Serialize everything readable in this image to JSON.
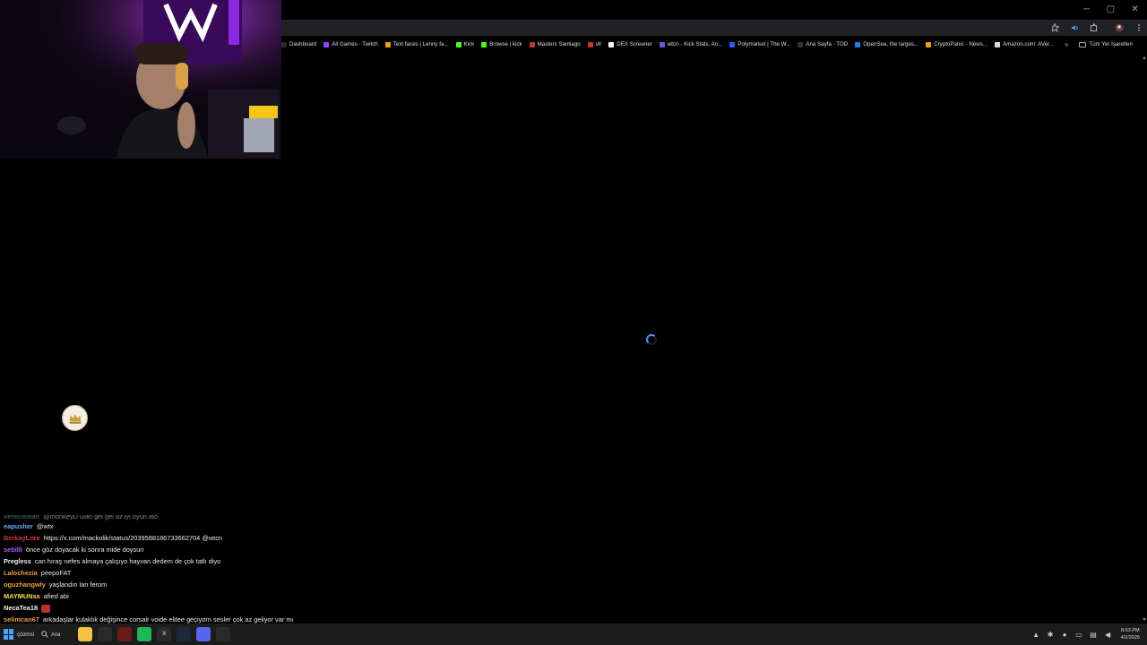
{
  "window_controls": {
    "minimize": "─",
    "maximize": "▢",
    "close": "✕"
  },
  "toolbar": {
    "icons": [
      "zoom-icon",
      "star-icon",
      "audio-icon",
      "extensions-icon",
      "profile-icon",
      "menu-icon"
    ]
  },
  "bookmarks": [
    {
      "label": "Dashboard",
      "color": "#2b2b2b"
    },
    {
      "label": "All Games - Twitch",
      "color": "#9146ff"
    },
    {
      "label": "Text faces | Lenny fa...",
      "color": "#e5a21a"
    },
    {
      "label": "Kick",
      "color": "#53fc18"
    },
    {
      "label": "Browse | kick",
      "color": "#53fc18"
    },
    {
      "label": "Masters Santiago",
      "color": "#b23b3b"
    },
    {
      "label": "vlr",
      "color": "#c0392b"
    },
    {
      "label": "DEX Screener",
      "color": "#ffffff"
    },
    {
      "label": "wtcn - Kick Stats, An...",
      "color": "#6a5acd"
    },
    {
      "label": "Polymarket | The W...",
      "color": "#2e5bff"
    },
    {
      "label": "Ana Sayfa - TOD",
      "color": "#333333"
    },
    {
      "label": "OpenSea, the larges...",
      "color": "#2081e2"
    },
    {
      "label": "CryptoPanic - News...",
      "color": "#f39c12"
    },
    {
      "label": "Amazon.com: AVer...",
      "color": "#dddddd"
    }
  ],
  "bookmarks_more": "»",
  "bookmarks_all": "Tüm Yer İşaretleri",
  "chat": {
    "faded_line": {
      "user": "vehicleman",
      "msg": "@monkeyD ulan gel gel az iyi oyun ato",
      "color": "#5f9ea0"
    },
    "lines": [
      {
        "user": "eapusher",
        "msg": "@wtx",
        "color": "#6fa8ff"
      },
      {
        "user": "BerkayLore",
        "msg": "https://x.com/mackolik/status/2039588186733662704 @wtcn",
        "color": "#d6323d"
      },
      {
        "user": "sebilli",
        "msg": "önce göz doyacak ki sonra mide doysun",
        "color": "#b05cff"
      },
      {
        "user": "Pregless",
        "msg": "can hıraş nefes almaya çalışıyo hayvan dedem de çok tatlı diyo",
        "color": "#f2f2f2"
      },
      {
        "user": "Lalochezia",
        "msg": "peepoFAT",
        "color": "#e6a23c"
      },
      {
        "user": "oguzhangwly",
        "msg": "yaşlandın lan ferom",
        "color": "#e6a23c"
      },
      {
        "user": "MAYMUNss",
        "msg": "afied abi",
        "color": "#f2e14b"
      },
      {
        "user": "NecaTea18",
        "msg": "",
        "color": "#f2f2f2",
        "emote": true
      },
      {
        "user": "selimcan67",
        "msg": "arkadaşlar kulaklık değişince corsair voide elitee geçiyorn sesler çok az geliyor var mı",
        "color": "#e6a23c"
      }
    ]
  },
  "taskbar": {
    "start_label": "çözmü",
    "search_label": "Ara",
    "apps": [
      {
        "name": "file-explorer",
        "color": "#f5c242",
        "glyph": ""
      },
      {
        "name": "chrome",
        "color": "#2a2a2a",
        "glyph": ""
      },
      {
        "name": "stream-app",
        "color": "#6b1a1a",
        "glyph": ""
      },
      {
        "name": "spotify",
        "color": "#1db954",
        "glyph": ""
      },
      {
        "name": "excel",
        "color": "#2a2a2a",
        "glyph": "X"
      },
      {
        "name": "steam",
        "color": "#1b2838",
        "glyph": ""
      },
      {
        "name": "discord",
        "color": "#5865f2",
        "glyph": ""
      },
      {
        "name": "obs",
        "color": "#2a2a2a",
        "glyph": ""
      }
    ],
    "clock_time": "8:53 PM",
    "clock_date": "4/2/2026"
  }
}
